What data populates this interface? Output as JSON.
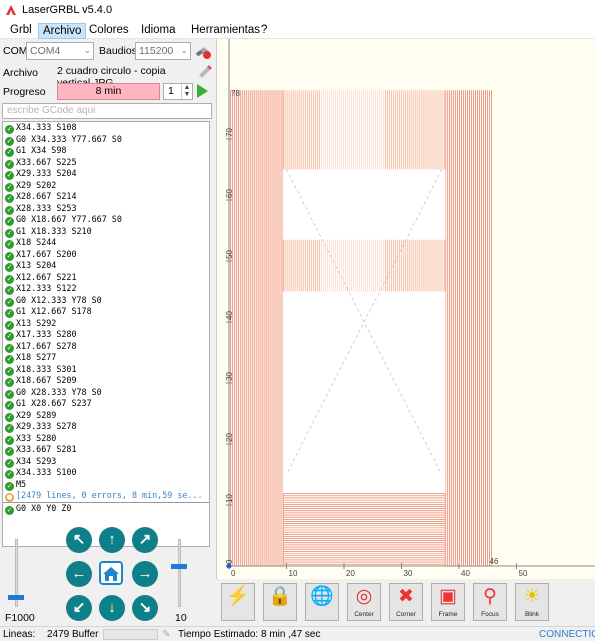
{
  "window": {
    "title": "LaserGRBL v5.4.0"
  },
  "menu": {
    "items": [
      "Grbl",
      "Archivo",
      "Colores",
      "Idioma",
      "Herramientas",
      "?"
    ]
  },
  "connection": {
    "com_label": "COM",
    "com_value": "COM4",
    "baud_label": "Baudios",
    "baud_value": "115200"
  },
  "file": {
    "label": "Archivo",
    "name": "2 cuadro circulo - copia vertical.JPG"
  },
  "progress": {
    "label": "Progreso",
    "value_text": "8 min",
    "passes": "1"
  },
  "gcode_input": {
    "placeholder": "escribe GCode aqui"
  },
  "log": [
    "X34.333 S108",
    "G0 X34.333 Y77.667 S0",
    "G1 X34 S98",
    "X33.667 S225",
    "X29.333 S204",
    "X29 S202",
    "X28.667 S214",
    "X28.333 S253",
    "G0 X18.667 Y77.667 S0",
    "G1 X18.333 S210",
    "X18 S244",
    "X17.667 S200",
    "X13 S204",
    "X12.667 S221",
    "X12.333 S122",
    "G0 X12.333 Y78 S0",
    "G1 X12.667 S178",
    "X13 S292",
    "X17.333 S280",
    "X17.667 S278",
    "X18 S277",
    "X18.333 S301",
    "X18.667 S209",
    "G0 X28.333 Y78 S0",
    "G1 X28.667 S237",
    "X29 S289",
    "X29.333 S278",
    "X33 S280",
    "X33.667 S281",
    "X34 S293",
    "X34.333 S100",
    "M5"
  ],
  "log_summary": "[2479 lines, 0 errors, 8 min,59 se...",
  "log_last": "G0 X0 Y0 Z0",
  "jog": {
    "speed_label": "F1000",
    "step_label": "10",
    "speed_level": 0.18,
    "step_level": 0.63
  },
  "canvas": {
    "y_ticks": [
      "0",
      "10",
      "20",
      "30",
      "40",
      "50",
      "60",
      "70",
      "78"
    ],
    "x_ticks": [
      "0",
      "10",
      "20",
      "30",
      "40",
      "46",
      "50"
    ],
    "colors": {
      "background": "#fffef0",
      "scan": "#e8443a",
      "grid": "#888888"
    }
  },
  "toolbar": {
    "buttons": [
      {
        "name": "run",
        "label": "",
        "icon": "lightning-icon"
      },
      {
        "name": "lock",
        "label": "",
        "icon": "padlock-icon"
      },
      {
        "name": "globe",
        "label": "",
        "icon": "globe-icon"
      },
      {
        "name": "center",
        "label": "Center",
        "icon": "target-icon"
      },
      {
        "name": "corner",
        "label": "Corner",
        "icon": "corner-icon"
      },
      {
        "name": "frame",
        "label": "Frame",
        "icon": "frame-icon"
      },
      {
        "name": "focus",
        "label": "Focus",
        "icon": "focus-icon"
      },
      {
        "name": "blink",
        "label": "Blink",
        "icon": "bulb-icon"
      }
    ]
  },
  "status": {
    "lines_label": "Lineas:",
    "lines_value": "2479",
    "buffer_label": "Buffer",
    "estimated": "Tiempo Estimado:  8 min ,47 sec",
    "connection": "CONNECTIO"
  }
}
